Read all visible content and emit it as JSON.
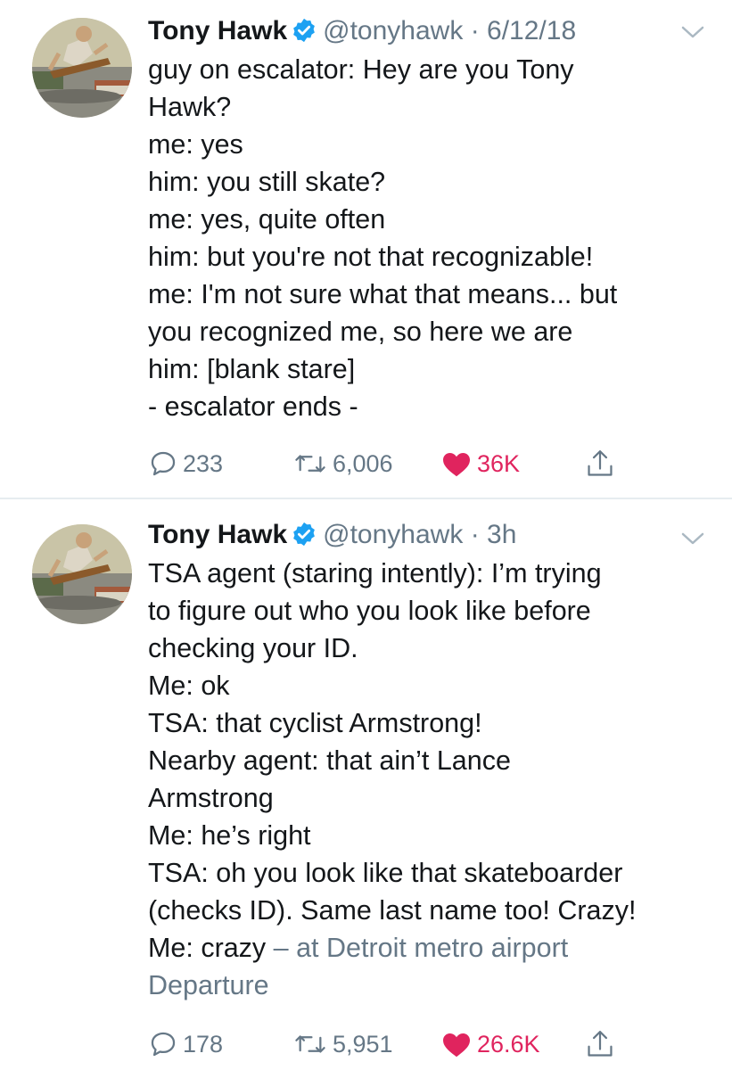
{
  "tweets": [
    {
      "name": "Tony Hawk",
      "handle": "@tonyhawk",
      "separator": "·",
      "time": "6/12/18",
      "lines": [
        "guy on escalator: Hey are you Tony",
        "Hawk?",
        "me: yes",
        "him: you still skate?",
        "me: yes, quite often",
        "him: but you're not that recognizable!",
        "me: I'm not sure what that means... but",
        "you recognized me, so here we are",
        "him: [blank stare]",
        "- escalator ends -"
      ],
      "replies": "233",
      "retweets": "6,006",
      "likes": "36K",
      "liked": true
    },
    {
      "name": "Tony Hawk",
      "handle": "@tonyhawk",
      "separator": "·",
      "time": "3h",
      "lines": [
        "TSA agent (staring intently): I’m trying",
        "to figure out who you look like before",
        "checking your ID.",
        "Me: ok",
        "TSA: that cyclist Armstrong!",
        "Nearby agent: that ain’t Lance",
        "Armstrong",
        "Me: he’s right",
        "TSA: oh you look like that skateboarder",
        "(checks ID). Same last name too! Crazy!"
      ],
      "last_line_text": "Me: crazy",
      "location_prefix": " – at Detroit metro airport",
      "location_cont": "Departure",
      "replies": "178",
      "retweets": "5,951",
      "likes": "26.6K",
      "liked": true
    }
  ],
  "icons": {
    "verified": "verified-badge-icon",
    "chevron": "chevron-down-icon",
    "reply": "reply-icon",
    "retweet": "retweet-icon",
    "like": "heart-icon",
    "share": "share-icon"
  },
  "colors": {
    "text": "#14171a",
    "secondary": "#657786",
    "verified": "#1da1f2",
    "like": "#e0245e",
    "divider": "#e6ecf0"
  }
}
